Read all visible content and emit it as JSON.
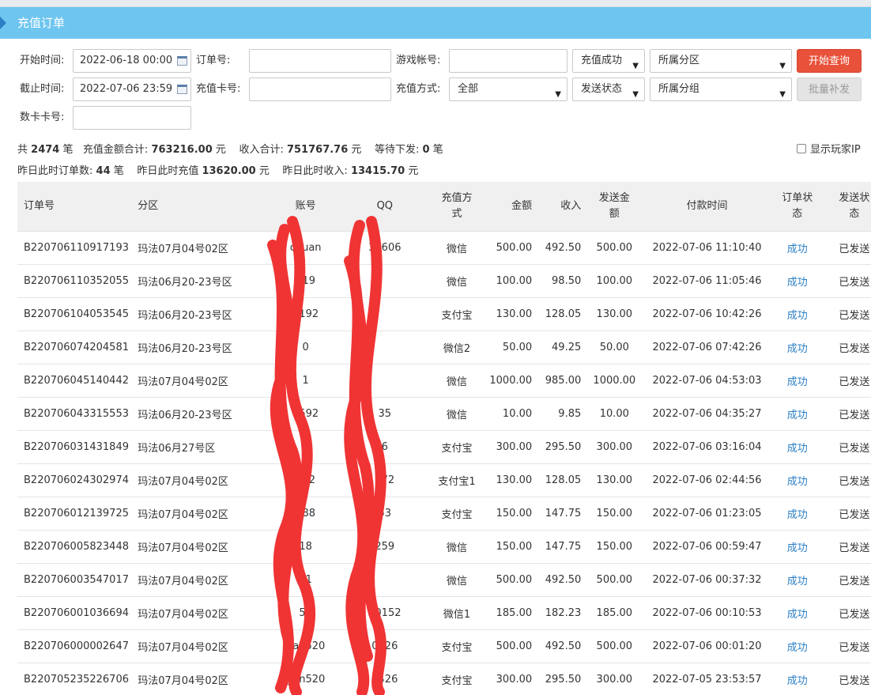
{
  "page": {
    "title": "充值订单"
  },
  "filters": {
    "start_time_label": "开始时间:",
    "start_time_value": "2022-06-18 00:00",
    "end_time_label": "截止时间:",
    "end_time_value": "2022-07-06 23:59",
    "card_no_label": "数卡卡号:",
    "order_no_label": "订单号:",
    "recharge_card_label": "充值卡号:",
    "game_account_label": "游戏帐号:",
    "recharge_method_label": "充值方式:",
    "recharge_method_value": "全部",
    "status_value": "充值成功",
    "send_status_value": "发送状态",
    "zone_value": "所属分区",
    "group_value": "所属分组",
    "query_button": "开始查询",
    "batch_button": "批量补发"
  },
  "stats": {
    "total_prefix": "共",
    "total_count": "2474",
    "total_unit": "笔",
    "amount_label": "充值金额合计:",
    "amount_value": "763216.00",
    "income_label": "收入合计:",
    "income_value": "751767.76",
    "yuan": "元",
    "pending_label": "等待下发:",
    "pending_value": "0",
    "y_orders_label": "昨日此时订单数:",
    "y_orders_value": "44",
    "y_recharge_label": "昨日此时充值",
    "y_recharge_value": "13620.00",
    "y_income_label": "昨日此时收入:",
    "y_income_value": "13415.70",
    "show_ip_label": "显示玩家IP"
  },
  "table": {
    "headers": {
      "order_no": "订单号",
      "zone": "分区",
      "account": "账号",
      "qq": "QQ",
      "method_1": "充值方",
      "method_2": "式",
      "amount": "金额",
      "income": "收入",
      "send_amount_1": "发送金",
      "send_amount_2": "额",
      "pay_time": "付款时间",
      "order_status_1": "订单状",
      "order_status_2": "态",
      "send_status_1": "发送状",
      "send_status_2": "态"
    },
    "rows": [
      {
        "order_no": "B220706110917193",
        "zone": "玛法07月04号02区",
        "account": "chuan",
        "qq": "38606",
        "method": "微信",
        "amount": "500.00",
        "income": "492.50",
        "send": "500.00",
        "time": "2022-07-06 11:10:40",
        "status": "成功",
        "sent": "已发送"
      },
      {
        "order_no": "B220706110352055",
        "zone": "玛法06月20-23号区",
        "account": "119",
        "qq": "",
        "method": "微信",
        "amount": "100.00",
        "income": "98.50",
        "send": "100.00",
        "time": "2022-07-06 11:05:46",
        "status": "成功",
        "sent": "已发送"
      },
      {
        "order_no": "B220706104053545",
        "zone": "玛法06月20-23号区",
        "account": "1192",
        "qq": "",
        "method": "支付宝",
        "amount": "130.00",
        "income": "128.05",
        "send": "130.00",
        "time": "2022-07-06 10:42:26",
        "status": "成功",
        "sent": "已发送"
      },
      {
        "order_no": "B220706074204581",
        "zone": "玛法06月20-23号区",
        "account": "0",
        "qq": "",
        "method": "微信2",
        "amount": "50.00",
        "income": "49.25",
        "send": "50.00",
        "time": "2022-07-06 07:42:26",
        "status": "成功",
        "sent": "已发送"
      },
      {
        "order_no": "B220706045140442",
        "zone": "玛法07月04号02区",
        "account": "1",
        "qq": "",
        "method": "微信",
        "amount": "1000.00",
        "income": "985.00",
        "send": "1000.00",
        "time": "2022-07-06 04:53:03",
        "status": "成功",
        "sent": "已发送"
      },
      {
        "order_no": "B220706043315553",
        "zone": "玛法06月20-23号区",
        "account": "4592",
        "qq": "35",
        "method": "微信",
        "amount": "10.00",
        "income": "9.85",
        "send": "10.00",
        "time": "2022-07-06 04:35:27",
        "status": "成功",
        "sent": "已发送"
      },
      {
        "order_no": "B220706031431849",
        "zone": "玛法06月27号区",
        "account": "1",
        "qq": "6",
        "method": "支付宝",
        "amount": "300.00",
        "income": "295.50",
        "send": "300.00",
        "time": "2022-07-06 03:16:04",
        "status": "成功",
        "sent": "已发送"
      },
      {
        "order_no": "B220706024302974",
        "zone": "玛法07月04号02区",
        "account": "172",
        "qq": "172",
        "method": "支付宝1",
        "amount": "130.00",
        "income": "128.05",
        "send": "130.00",
        "time": "2022-07-06 02:44:56",
        "status": "成功",
        "sent": "已发送"
      },
      {
        "order_no": "B220706012139725",
        "zone": "玛法07月04号02区",
        "account": "188",
        "qq": "53",
        "method": "支付宝",
        "amount": "150.00",
        "income": "147.75",
        "send": "150.00",
        "time": "2022-07-06 01:23:05",
        "status": "成功",
        "sent": "已发送"
      },
      {
        "order_no": "B220706005823448",
        "zone": "玛法07月04号02区",
        "account": "18",
        "qq": "259",
        "method": "微信",
        "amount": "150.00",
        "income": "147.75",
        "send": "150.00",
        "time": "2022-07-06 00:59:47",
        "status": "成功",
        "sent": "已发送"
      },
      {
        "order_no": "B220706003547017",
        "zone": "玛法07月04号02区",
        "account": "31",
        "qq": "",
        "method": "微信",
        "amount": "500.00",
        "income": "492.50",
        "send": "500.00",
        "time": "2022-07-06 00:37:32",
        "status": "成功",
        "sent": "已发送"
      },
      {
        "order_no": "B220706001036694",
        "zone": "玛法07月04号02区",
        "account": "50",
        "qq": "50152",
        "method": "微信1",
        "amount": "185.00",
        "income": "182.23",
        "send": "185.00",
        "time": "2022-07-06 00:10:53",
        "status": "成功",
        "sent": "已发送"
      },
      {
        "order_no": "B220706000002647",
        "zone": "玛法07月04号02区",
        "account": "gan520",
        "qq": "0426",
        "method": "支付宝",
        "amount": "500.00",
        "income": "492.50",
        "send": "500.00",
        "time": "2022-07-06 00:01:20",
        "status": "成功",
        "sent": "已发送"
      },
      {
        "order_no": "B220705235226706",
        "zone": "玛法07月04号02区",
        "account": "gan520",
        "qq": "0426",
        "method": "支付宝",
        "amount": "300.00",
        "income": "295.50",
        "send": "300.00",
        "time": "2022-07-05 23:53:57",
        "status": "成功",
        "sent": "已发送"
      }
    ]
  }
}
